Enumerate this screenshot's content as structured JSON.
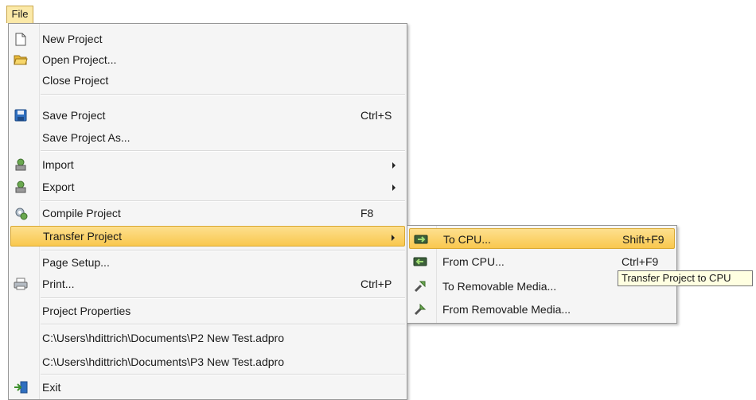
{
  "menubar": {
    "file_label": "File"
  },
  "file_menu": {
    "new_project": {
      "label": "New Project",
      "icon": "new-document-icon"
    },
    "open_project": {
      "label": "Open Project...",
      "icon": "folder-open-icon"
    },
    "close_project": {
      "label": "Close Project"
    },
    "save_project": {
      "label": "Save Project",
      "shortcut": "Ctrl+S",
      "icon": "floppy-disk-icon"
    },
    "save_project_as": {
      "label": "Save Project As..."
    },
    "import": {
      "label": "Import",
      "icon": "import-icon"
    },
    "export": {
      "label": "Export",
      "icon": "export-icon"
    },
    "compile_project": {
      "label": "Compile Project",
      "shortcut": "F8",
      "icon": "compile-icon"
    },
    "transfer_project": {
      "label": "Transfer Project"
    },
    "page_setup": {
      "label": "Page Setup..."
    },
    "print": {
      "label": "Print...",
      "shortcut": "Ctrl+P",
      "icon": "printer-icon"
    },
    "project_properties": {
      "label": "Project Properties"
    },
    "recent_1": {
      "label": "C:\\Users\\hdittrich\\Documents\\P2 New Test.adpro"
    },
    "recent_2": {
      "label": "C:\\Users\\hdittrich\\Documents\\P3 New Test.adpro"
    },
    "exit": {
      "label": "Exit",
      "icon": "exit-icon"
    }
  },
  "transfer_submenu": {
    "to_cpu": {
      "label": "To CPU...",
      "shortcut": "Shift+F9",
      "icon": "to-cpu-icon"
    },
    "from_cpu": {
      "label": "From CPU...",
      "shortcut": "Ctrl+F9",
      "icon": "from-cpu-icon"
    },
    "to_removable": {
      "label": "To Removable Media...",
      "icon": "to-removable-media-icon"
    },
    "from_removable": {
      "label": "From Removable Media...",
      "icon": "from-removable-media-icon"
    }
  },
  "tooltip": {
    "text": "Transfer Project to CPU"
  },
  "colors": {
    "highlight": "#f9c84e",
    "menu_bg": "#f5f5f5",
    "tooltip_bg": "#ffffe1"
  }
}
